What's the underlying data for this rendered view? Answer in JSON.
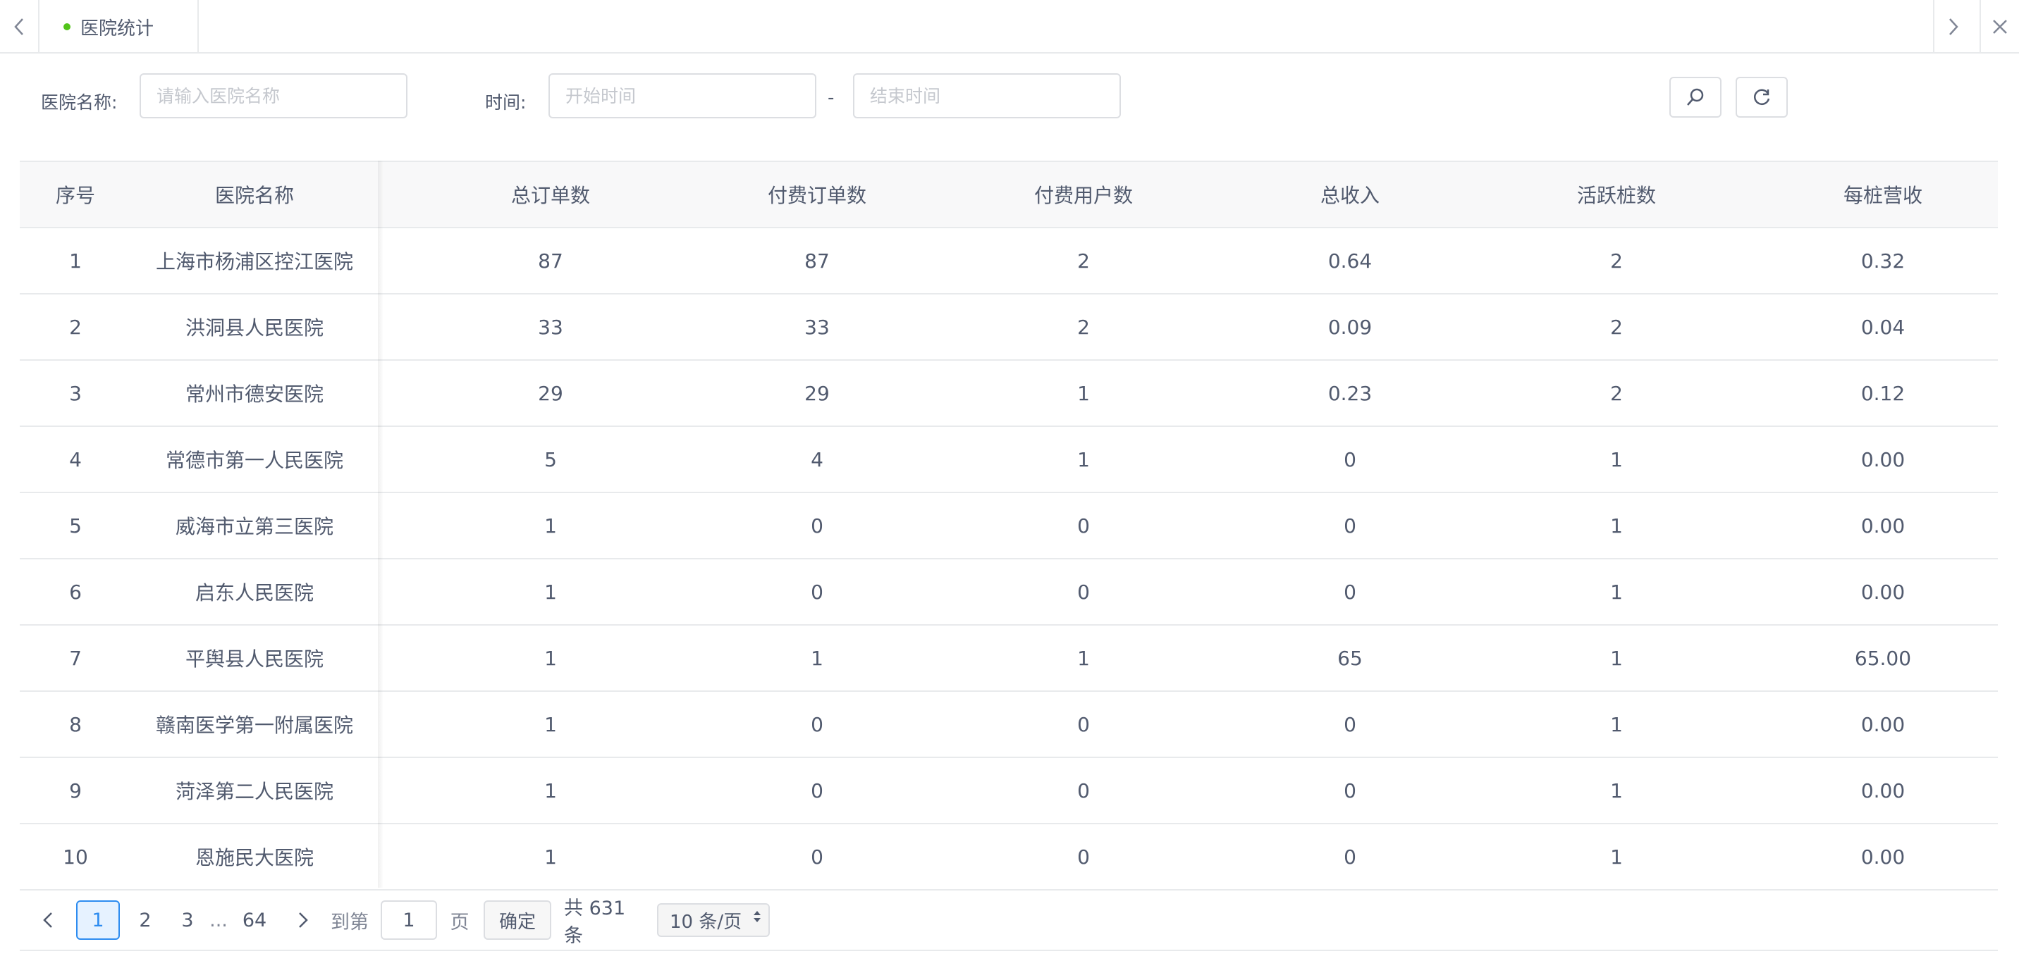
{
  "tabbar": {
    "active_tab": "医院统计",
    "accent": "#52c41a"
  },
  "filters": {
    "hospital_label": "医院名称:",
    "hospital_placeholder": "请输入医院名称",
    "time_label": "时间:",
    "start_placeholder": "开始时间",
    "separator": "-",
    "end_placeholder": "结束时间",
    "search_icon": "search-icon",
    "refresh_icon": "refresh-icon"
  },
  "table": {
    "columns": [
      "序号",
      "医院名称",
      "总订单数",
      "付费订单数",
      "付费用户数",
      "总收入",
      "活跃桩数",
      "每桩营收"
    ],
    "rows": [
      [
        "1",
        "上海市杨浦区控江医院",
        "87",
        "87",
        "2",
        "0.64",
        "2",
        "0.32"
      ],
      [
        "2",
        "洪洞县人民医院",
        "33",
        "33",
        "2",
        "0.09",
        "2",
        "0.04"
      ],
      [
        "3",
        "常州市德安医院",
        "29",
        "29",
        "1",
        "0.23",
        "2",
        "0.12"
      ],
      [
        "4",
        "常德市第一人民医院",
        "5",
        "4",
        "1",
        "0",
        "1",
        "0.00"
      ],
      [
        "5",
        "威海市立第三医院",
        "1",
        "0",
        "0",
        "0",
        "1",
        "0.00"
      ],
      [
        "6",
        "启东人民医院",
        "1",
        "0",
        "0",
        "0",
        "1",
        "0.00"
      ],
      [
        "7",
        "平舆县人民医院",
        "1",
        "1",
        "1",
        "65",
        "1",
        "65.00"
      ],
      [
        "8",
        "赣南医学第一附属医院",
        "1",
        "0",
        "0",
        "0",
        "1",
        "0.00"
      ],
      [
        "9",
        "菏泽第二人民医院",
        "1",
        "0",
        "0",
        "0",
        "1",
        "0.00"
      ],
      [
        "10",
        "恩施民大医院",
        "1",
        "0",
        "0",
        "0",
        "1",
        "0.00"
      ]
    ]
  },
  "pagination": {
    "pages": [
      "1",
      "2",
      "3"
    ],
    "ellipsis": "...",
    "last_page": "64",
    "current": "1",
    "goto_prefix": "到第",
    "goto_value": "1",
    "goto_suffix": "页",
    "confirm": "确定",
    "total": "共 631 条",
    "page_size": "10 条/页",
    "accent": "#2d8cf0"
  }
}
